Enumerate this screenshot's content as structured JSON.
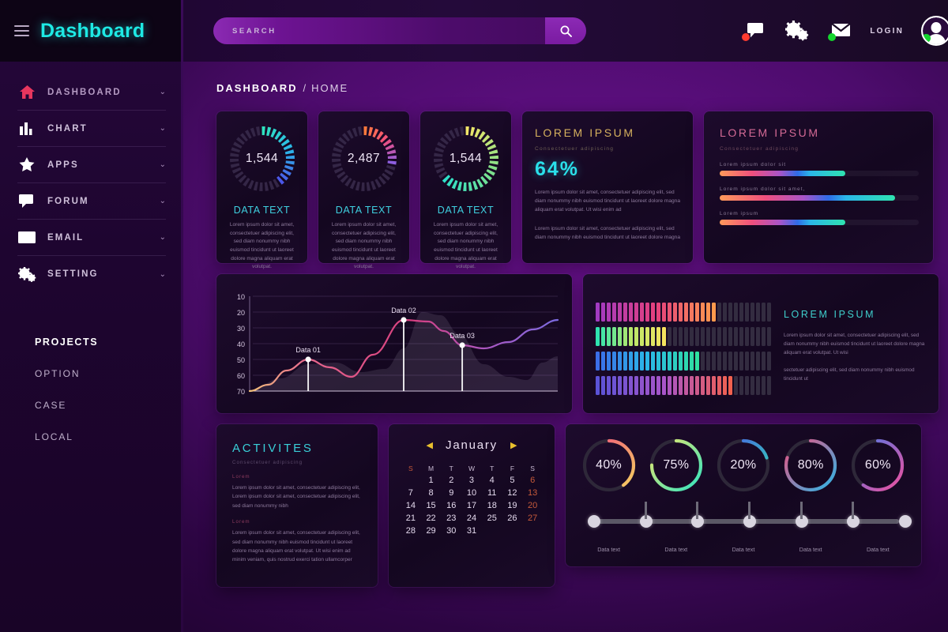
{
  "brand": {
    "title": "Dashboard",
    "hamburger_icon": "hamburger-icon"
  },
  "search": {
    "placeholder": "SEARCH",
    "value": "",
    "icon": "search-icon"
  },
  "topbar": {
    "chat_icon": "chat-bubble-icon",
    "settings_icon": "gear-icon",
    "mail_icon": "envelope-icon",
    "login_label": "LOGIN",
    "avatar_icon": "user-avatar-icon"
  },
  "sidebar": {
    "items": [
      {
        "label": "DASHBOARD",
        "icon": "home-icon",
        "chevron": "⌄",
        "active": true
      },
      {
        "label": "CHART",
        "icon": "bar-chart-icon",
        "chevron": "⌄",
        "active": false
      },
      {
        "label": "APPS",
        "icon": "star-icon",
        "chevron": "⌄",
        "active": false
      },
      {
        "label": "FORUM",
        "icon": "chat-bubble-icon",
        "chevron": "⌄",
        "active": false
      },
      {
        "label": "EMAIL",
        "icon": "envelope-icon",
        "chevron": "⌄",
        "active": false
      },
      {
        "label": "SETTING",
        "icon": "gear-icon",
        "chevron": "⌄",
        "active": false
      }
    ],
    "projects_title": "PROJECTS",
    "projects": [
      "OPTION",
      "CASE",
      "LOCAL"
    ]
  },
  "breadcrumb": {
    "main": "DASHBOARD",
    "separator": "/",
    "sub": "HOME"
  },
  "kpi_cards": [
    {
      "value": "1,544",
      "label": "DATA TEXT",
      "desc": "Lorem ipsum dolor sit amet, consectetuer adipiscing elit, sed diam nonummy nibh euismod tincidunt ut laoreet dolore magna aliquam erat volutpat.",
      "percent": 42,
      "colors": [
        "#2fe3c0",
        "#2bb7e8",
        "#4b57e8"
      ]
    },
    {
      "value": "2,487",
      "label": "DATA TEXT",
      "desc": "Lorem ipsum dolor sit amet, consectetuer adipiscing elit, sed diam nonummy nibh euismod tincidunt ut laoreet dolore magna aliquam erat volutpat.",
      "percent": 30,
      "colors": [
        "#ff7a3d",
        "#ef4f7e",
        "#8e5fe0"
      ]
    },
    {
      "value": "1,544",
      "label": "DATA TEXT",
      "desc": "Lorem ipsum dolor sit amet, consectetuer adipiscing elit, sed diam nonummy nibh euismod tincidunt ut laoreet dolore magna aliquam erat volutpat.",
      "percent": 66,
      "colors": [
        "#f3e769",
        "#7fe08a",
        "#2fe0c8"
      ]
    }
  ],
  "lorem_card": {
    "title": "LOREM IPSUM",
    "subtitle": "Consectetuer adipiscing",
    "percent_label": "64%",
    "body1": "Lorem ipsum dolor sit amet, consectetuer adipiscing elit, sed diam nonummy nibh euismod tincidunt ut laoreet dolore magna aliquam erat volutpat. Ut wisi enim ad",
    "body2": "Lorem ipsum dolor sit amet, consectetuer adipiscing elit, sed diam nonummy nibh euismod tincidunt ut laoreet dolore magna"
  },
  "bars_card": {
    "title": "LOREM IPSUM",
    "subtitle": "Consectetuer adipiscing",
    "bars": [
      {
        "label": "Lorem ipsum dolor sit",
        "percent": 63
      },
      {
        "label": "Lorem ipsum dolor sit amet,",
        "percent": 88
      },
      {
        "label": "Lorem ipsum",
        "percent": 63
      }
    ]
  },
  "chart_data": [
    {
      "type": "line",
      "title": "",
      "xlabel": "",
      "ylabel": "",
      "y_ticks": [
        10,
        20,
        30,
        40,
        50,
        60,
        70
      ],
      "ylim": [
        70,
        10
      ],
      "y_axis_inverted": true,
      "grid": true,
      "annotations": [
        {
          "label": "Data 01",
          "x": 19,
          "y": 50
        },
        {
          "label": "Data 02",
          "x": 50,
          "y": 25
        },
        {
          "label": "Data 03",
          "x": 69,
          "y": 41
        }
      ],
      "series": [
        {
          "name": "main-line",
          "x": [
            0,
            6,
            12,
            19,
            26,
            33,
            40,
            50,
            58,
            63,
            69,
            76,
            84,
            92,
            100
          ],
          "values": [
            70,
            66,
            57,
            50,
            55,
            61,
            47,
            25,
            26,
            32,
            41,
            43,
            39,
            31,
            25
          ]
        },
        {
          "name": "area-shadow",
          "x": [
            0,
            10,
            19,
            28,
            36,
            44,
            50,
            56,
            62,
            68,
            76,
            84,
            90,
            95,
            100
          ],
          "values": [
            70,
            62,
            53,
            52,
            58,
            56,
            43,
            20,
            22,
            34,
            53,
            61,
            63,
            52,
            48
          ]
        }
      ]
    },
    {
      "type": "heatmap",
      "title": "LOREM IPSUM",
      "columns": 32,
      "rows": [
        {
          "filled": 22,
          "colors": [
            "#a33bc2",
            "#e5407d",
            "#ff9a4d"
          ]
        },
        {
          "filled": 13,
          "colors": [
            "#2fe3b0",
            "#b7e86a",
            "#f5e35f"
          ]
        },
        {
          "filled": 19,
          "colors": [
            "#3b6ee8",
            "#2bb7e8",
            "#2fe0a0"
          ]
        },
        {
          "filled": 25,
          "colors": [
            "#5b53d6",
            "#a855c9",
            "#f2614f"
          ]
        }
      ],
      "body1": "Lorem ipsum dolor sit amet, consectetuer adipiscing elit, sed diam nonummy nibh euismod tincidunt ut laoreet dolore magna aliquam erat volutpat. Ut wisi",
      "body2": "sectetuer adipiscing elit, sed diam nonummy nibh euismod tincidunt ut"
    },
    {
      "type": "pie",
      "title": "",
      "categories": [
        "Data text",
        "Data text",
        "Data text",
        "Data text",
        "Data text"
      ],
      "values": [
        40,
        75,
        20,
        80,
        60
      ],
      "labels": [
        "40%",
        "75%",
        "20%",
        "80%",
        "60%"
      ]
    }
  ],
  "activities": {
    "title": "ACTIVITES",
    "subtitle": "Consectetuer adipiscing",
    "entries": [
      {
        "tag": "Lorem",
        "body": "Lorem ipsum dolor sit amet, consectetuer adipiscing elit, Lorem ipsum dolor sit amet, consectetuer adipiscing elit, sed diam nonummy nibh"
      },
      {
        "tag": "Lorem",
        "body": "Lorem ipsum dolor sit amet, consectetuer adipiscing elit, sed diam nonummy nibh euismod tincidunt ut laoreet dolore magna aliquam erat volutpat. Ut wisi enim ad minim veniam, quis nostrud exerci tation ullamcorper"
      }
    ]
  },
  "calendar": {
    "month": "January",
    "prev_icon": "triangle-left-icon",
    "next_icon": "triangle-right-icon",
    "dow": [
      "S",
      "M",
      "T",
      "W",
      "T",
      "F",
      "S"
    ],
    "leading_blanks": 1,
    "days": [
      1,
      2,
      3,
      4,
      5,
      6,
      7,
      8,
      9,
      10,
      11,
      12,
      13,
      14,
      15,
      16,
      17,
      18,
      19,
      20,
      21,
      22,
      23,
      24,
      25,
      26,
      27,
      28,
      29,
      30,
      31
    ],
    "sundays": [
      6,
      13,
      20,
      27
    ]
  },
  "donuts": {
    "items": [
      {
        "label": "40%",
        "percent": 40,
        "caption": "Data text",
        "colors": [
          "#f5d35f",
          "#ef4f7e"
        ]
      },
      {
        "label": "75%",
        "percent": 75,
        "caption": "Data text",
        "colors": [
          "#2fe3c0",
          "#f3e769"
        ]
      },
      {
        "label": "20%",
        "percent": 20,
        "caption": "Data text",
        "colors": [
          "#2fe3b0",
          "#4b57e8"
        ]
      },
      {
        "label": "80%",
        "percent": 80,
        "caption": "Data text",
        "colors": [
          "#2bb7e8",
          "#ef4f7e"
        ]
      },
      {
        "label": "60%",
        "percent": 60,
        "caption": "Data text",
        "colors": [
          "#ef4f9e",
          "#4b7ae8"
        ]
      }
    ]
  },
  "theme": {
    "accent_cyan": "#1ee9e4",
    "accent_purple": "#6c1191",
    "sidebar_bg": "#1e0530",
    "card_bg": "#160a22"
  }
}
